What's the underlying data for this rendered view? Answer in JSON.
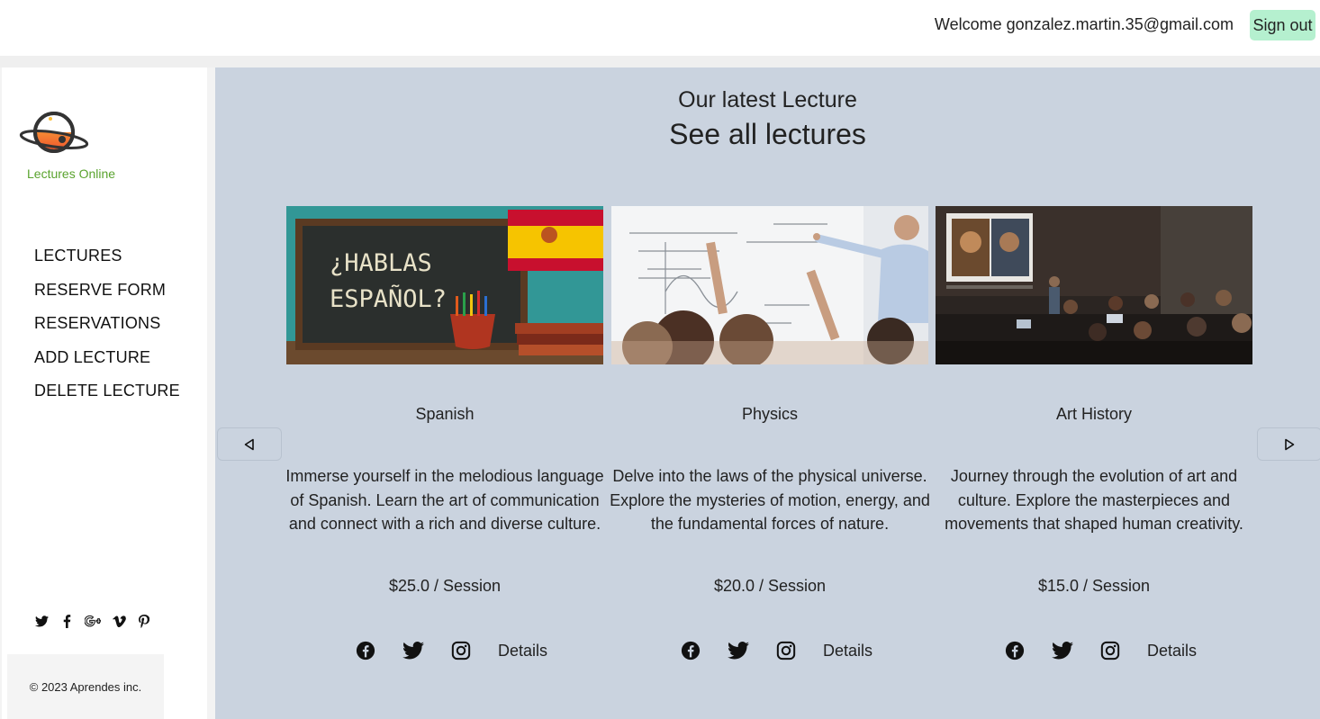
{
  "header": {
    "welcome": "Welcome gonzalez.martin.35@gmail.com",
    "signout": "Sign out",
    "signout_color": "#b5f0cf"
  },
  "sidebar": {
    "logo_text": "Lectures Online",
    "nav": [
      "LECTURES",
      "RESERVE FORM",
      "RESERVATIONS",
      "ADD LECTURE",
      "DELETE LECTURE"
    ],
    "socials": [
      "twitter-icon",
      "facebook-icon",
      "google-plus-icon",
      "vimeo-icon",
      "pinterest-icon"
    ],
    "footer": "© 2023 Aprendes inc."
  },
  "main": {
    "background": "#cad3df",
    "subtitle": "Our latest Lecture",
    "title": "See all lectures",
    "prev_icon": "triangle-left-icon",
    "next_icon": "triangle-right-icon",
    "cards": [
      {
        "title": "Spanish",
        "image_text": "¿HABLAS ESPAÑOL?",
        "description": "Immerse yourself in the melodious language of Spanish. Learn the art of communication and connect with a rich and diverse culture.",
        "price": "$25.0 / Session",
        "details": "Details"
      },
      {
        "title": "Physics",
        "description": "Delve into the laws of the physical universe. Explore the mysteries of motion, energy, and the fundamental forces of nature.",
        "price": "$20.0 / Session",
        "details": "Details"
      },
      {
        "title": "Art History",
        "description": "Journey through the evolution of art and culture. Explore the masterpieces and movements that shaped human creativity.",
        "price": "$15.0 / Session",
        "details": "Details"
      }
    ]
  }
}
